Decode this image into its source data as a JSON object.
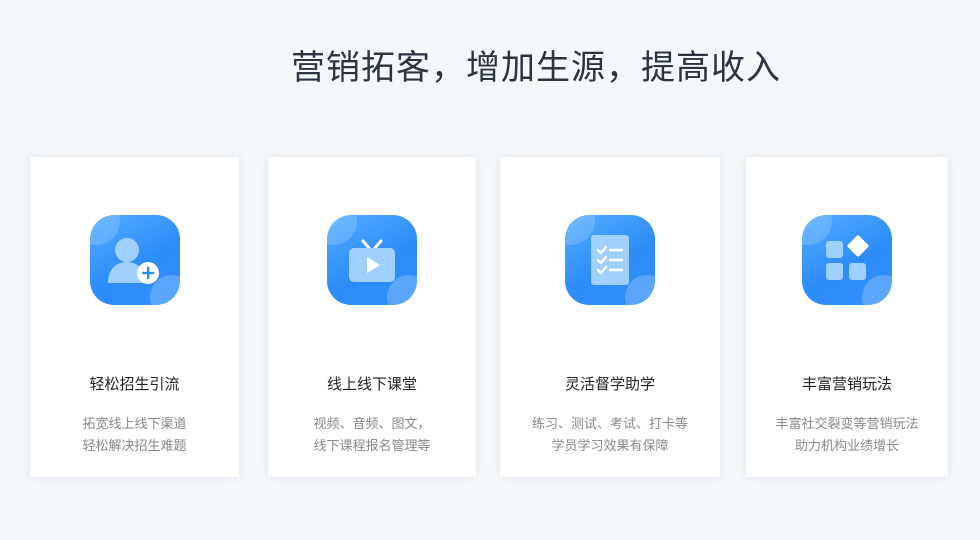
{
  "headline": "营销拓客，增加生源，提高收入",
  "accent_color": "#2d8cf8",
  "cards": [
    {
      "icon": "add-user-icon",
      "title": "轻松招生引流",
      "desc_lines": [
        "拓宽线上线下渠道",
        "轻松解决招生难题"
      ]
    },
    {
      "icon": "tv-play-icon",
      "title": "线上线下课堂",
      "desc_lines": [
        "视频、音频、图文，",
        "线下课程报名管理等"
      ]
    },
    {
      "icon": "checklist-icon",
      "title": "灵活督学助学",
      "desc_lines": [
        "练习、测试、考试、打卡等",
        "学员学习效果有保障"
      ]
    },
    {
      "icon": "apps-grid-icon",
      "title": "丰富营销玩法",
      "desc_lines": [
        "丰富社交裂变等营销玩法",
        "助力机构业绩增长"
      ]
    }
  ]
}
